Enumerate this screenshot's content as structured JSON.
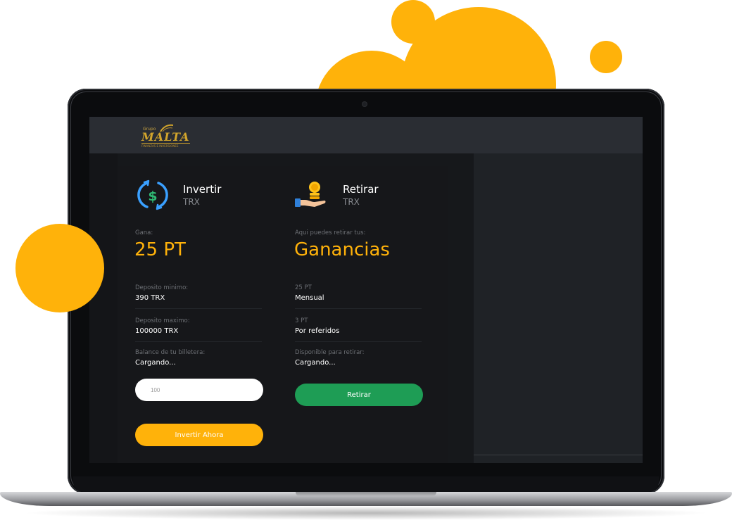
{
  "header": {
    "logo_top": "Grupo",
    "logo_main": "MALTA",
    "logo_sub": "FINANZAS E INVERSIONES"
  },
  "invest": {
    "icon": "dollar-exchange-icon",
    "title": "Invertir",
    "currency": "TRX",
    "earn_label": "Gana:",
    "earn_value": "25 PT",
    "min_label": "Deposito minimo:",
    "min_value": "390 TRX",
    "max_label": "Deposito maximo:",
    "max_value": "100000 TRX",
    "balance_label": "Balance de tu billetera:",
    "balance_value": "Cargando...",
    "amount_placeholder": "100",
    "invest_button": "Invertir Ahora"
  },
  "withdraw": {
    "icon": "coin-hand-icon",
    "title": "Retirar",
    "currency": "TRX",
    "intro_label": "Aqui puedes retirar tus:",
    "intro_value": "Ganancias",
    "rate1_label": "25 PT",
    "rate1_value": "Mensual",
    "rate2_label": "3 PT",
    "rate2_value": "Por referidos",
    "available_label": "Disponible para retirar:",
    "available_value": "Cargando...",
    "withdraw_button": "Retirar"
  },
  "colors": {
    "accent": "#ffb20a",
    "success": "#1e9d55",
    "background": "#16181b",
    "header": "#2a2d33"
  }
}
